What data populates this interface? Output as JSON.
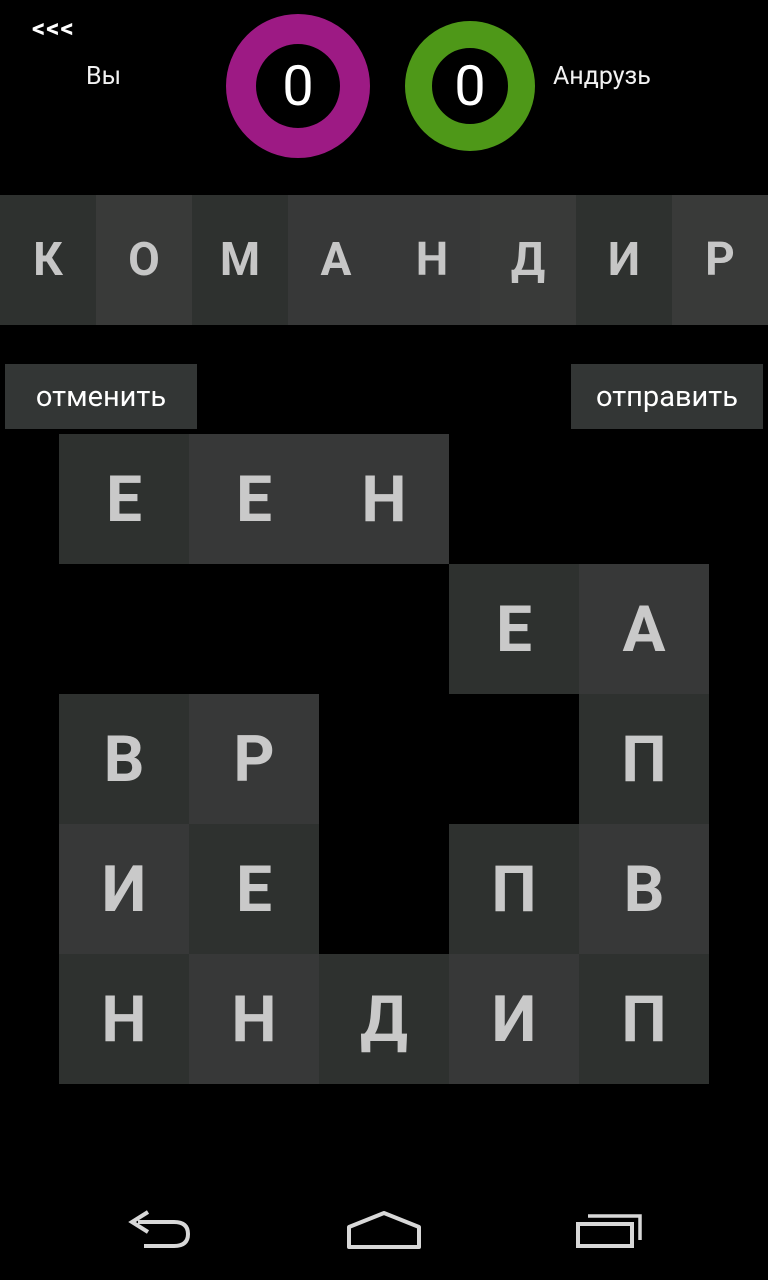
{
  "header": {
    "back_label": "<<<",
    "player_you": "Вы",
    "player_opponent": "Андрузь",
    "score_you": "0",
    "score_opponent": "0",
    "color_you": "#9d1a84",
    "color_opponent": "#4e9818"
  },
  "word_letters": [
    "К",
    "О",
    "М",
    "А",
    "Н",
    "Д",
    "И",
    "Р"
  ],
  "buttons": {
    "cancel": "отменить",
    "send": "отправить"
  },
  "board": {
    "rows": [
      [
        "Е",
        "Е",
        "Н",
        "",
        ""
      ],
      [
        "",
        "",
        "",
        "Е",
        "А"
      ],
      [
        "В",
        "Р",
        "",
        "",
        "П"
      ],
      [
        "И",
        "Е",
        "",
        "П",
        "В"
      ],
      [
        "Н",
        "Н",
        "Д",
        "И",
        "П"
      ]
    ]
  },
  "nav": {
    "back_icon": "back-arrow-icon",
    "home_icon": "home-icon",
    "recent_icon": "recent-apps-icon"
  }
}
